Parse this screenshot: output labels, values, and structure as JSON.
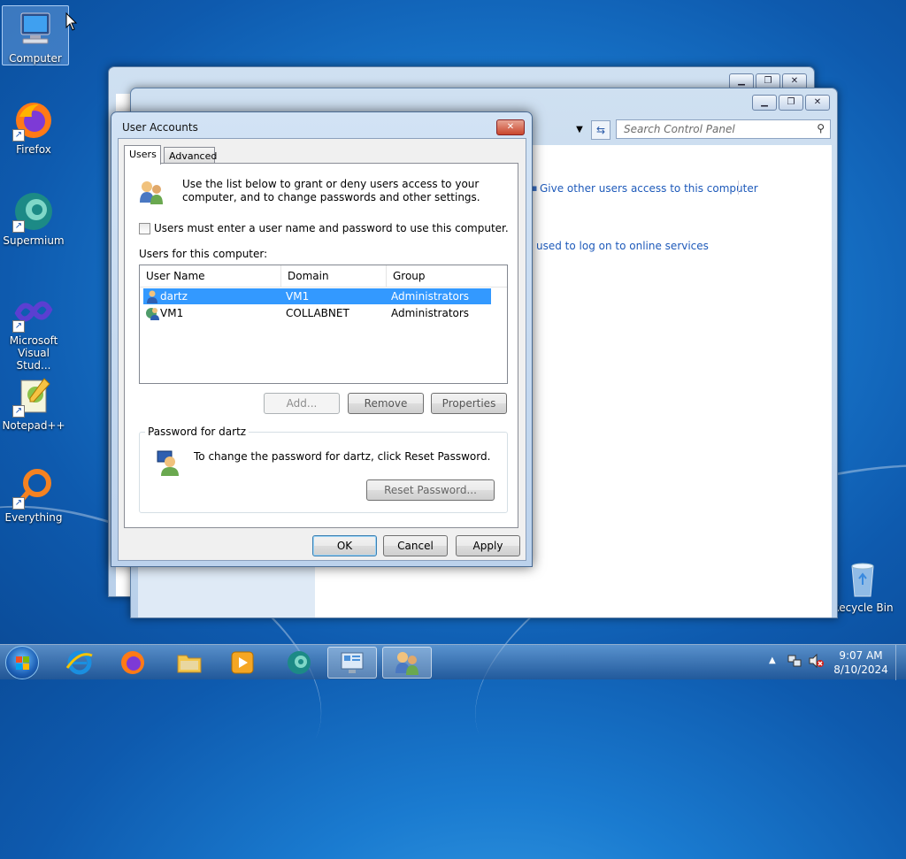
{
  "desktop": {
    "icons": [
      {
        "label": "Computer",
        "icon": "computer-icon"
      },
      {
        "label": "Firefox",
        "icon": "firefox-icon"
      },
      {
        "label": "Supermium",
        "icon": "supermium-icon"
      },
      {
        "label": "Microsoft Visual Stud...",
        "icon": "visual-studio-icon"
      },
      {
        "label": "Notepad++",
        "icon": "notepadpp-icon"
      },
      {
        "label": "Everything",
        "icon": "everything-icon"
      },
      {
        "label": "Recycle Bin",
        "icon": "recycle-bin-icon"
      }
    ]
  },
  "control_panel": {
    "search_placeholder": "Search Control Panel",
    "link_give_access": "Give other users access to this computer",
    "link_online_services": "used to log on to online services"
  },
  "dialog": {
    "title": "User Accounts",
    "tabs": [
      "Users",
      "Advanced"
    ],
    "intro": "Use the list below to grant or deny users access to your computer, and to change passwords and other settings.",
    "checkbox_label": "Users must enter a user name and password to use this computer.",
    "checkbox_checked": false,
    "users_label": "Users for this computer:",
    "columns": [
      "User Name",
      "Domain",
      "Group"
    ],
    "rows": [
      {
        "user": "dartz",
        "domain": "VM1",
        "group": "Administrators",
        "selected": true
      },
      {
        "user": "VM1",
        "domain": "COLLABNET",
        "group": "Administrators",
        "selected": false
      }
    ],
    "buttons": {
      "add": "Add...",
      "remove": "Remove",
      "properties": "Properties",
      "reset": "Reset Password...",
      "ok": "OK",
      "cancel": "Cancel",
      "apply": "Apply"
    },
    "password_group_label": "Password for dartz",
    "password_text": "To change the password for dartz, click Reset Password."
  },
  "taskbar": {
    "time": "9:07 AM",
    "date": "8/10/2024",
    "items": [
      "start-orb",
      "internet-explorer-icon",
      "firefox-icon",
      "file-explorer-icon",
      "media-player-icon",
      "supermium-icon",
      "control-panel-icon",
      "user-accounts-icon"
    ]
  }
}
